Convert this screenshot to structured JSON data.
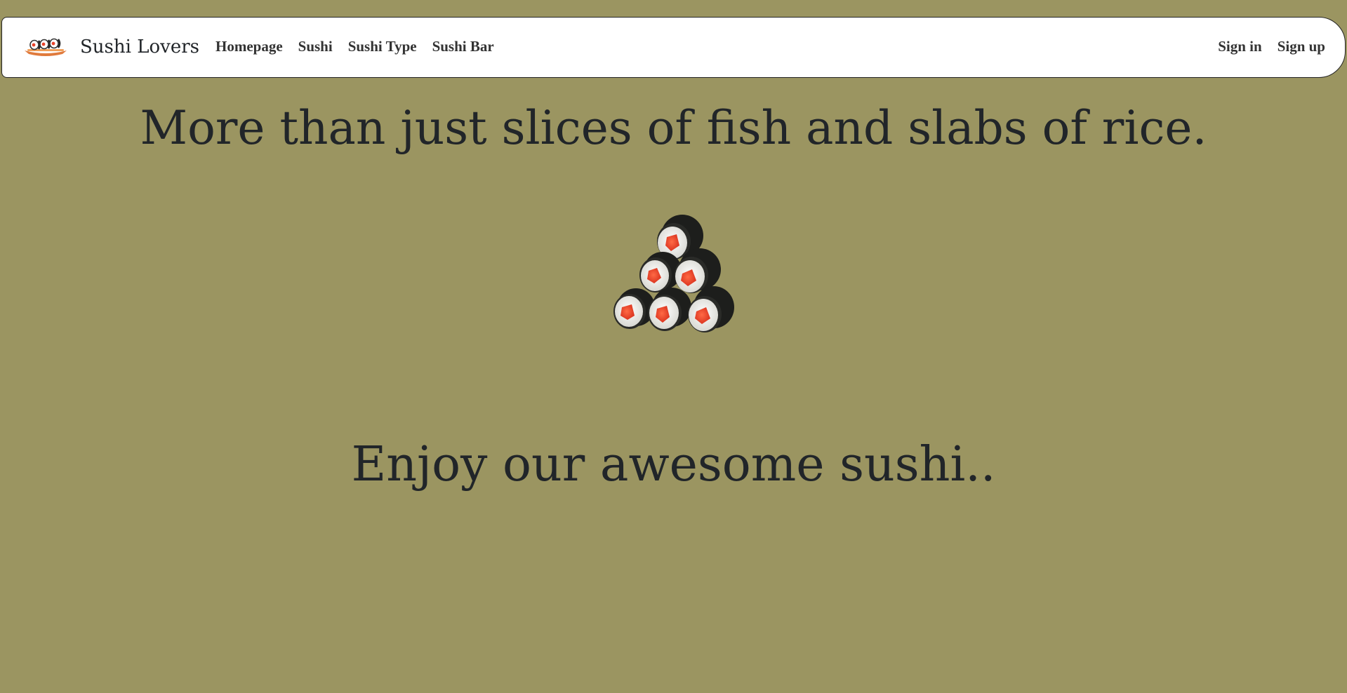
{
  "navbar": {
    "brand_name": "Sushi Lovers",
    "brand_logo_icon": "sushi-boat-logo",
    "links": [
      {
        "label": "Homepage"
      },
      {
        "label": "Sushi"
      },
      {
        "label": "Sushi Type"
      },
      {
        "label": "Sushi Bar"
      }
    ],
    "auth": {
      "sign_in": "Sign in",
      "sign_up": "Sign up"
    }
  },
  "hero": {
    "headline": "More than just slices of fish and slabs of rice.",
    "image_icon": "sushi-rolls-pyramid",
    "subheadline": "Enjoy our awesome sushi.."
  },
  "colors": {
    "background": "#9b9561",
    "navbar_bg": "#ffffff",
    "text": "#212529",
    "nori": "#1e1f1d",
    "rice": "#f2f2ee",
    "salmon": "#e8432a"
  }
}
